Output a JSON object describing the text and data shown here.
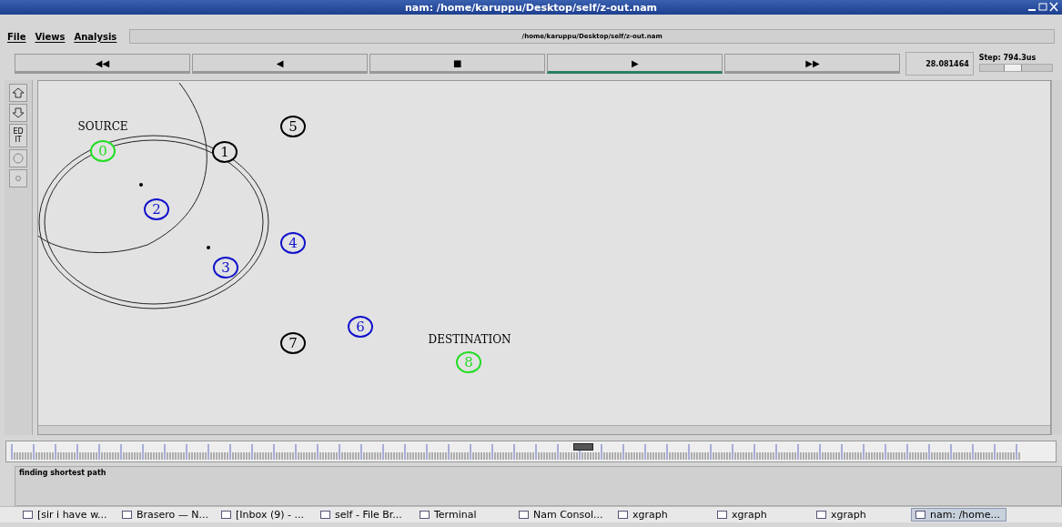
{
  "window": {
    "title": "nam: /home/karuppu/Desktop/self/z-out.nam"
  },
  "menu": [
    {
      "label": "File"
    },
    {
      "label": "Views"
    },
    {
      "label": "Analysis"
    }
  ],
  "file_path": "/home/karuppu/Desktop/self/z-out.nam",
  "controls": [
    {
      "label": "◀◀",
      "selected": false
    },
    {
      "label": "◀",
      "selected": false
    },
    {
      "label": "■",
      "selected": false
    },
    {
      "label": "▶",
      "selected": true
    },
    {
      "label": "▶▶",
      "selected": false
    }
  ],
  "time": "28.081464",
  "step": {
    "label": "Step: 794.3us",
    "level": 0.45
  },
  "tools": [
    {
      "kind": "up"
    },
    {
      "kind": "down"
    },
    {
      "kind": "edit",
      "label": "ED IT"
    },
    {
      "kind": "circle"
    },
    {
      "kind": "dot"
    }
  ],
  "canvas": {
    "labels": [
      {
        "text": "SOURCE"
      },
      {
        "text": "DESTINATION"
      }
    ],
    "nodes": [
      {
        "label": "5",
        "color": "#000000"
      },
      {
        "label": "0",
        "color": "#22dd22"
      },
      {
        "label": "1",
        "color": "#000000"
      },
      {
        "label": "2",
        "color": "#1111cc"
      },
      {
        "label": "4",
        "color": "#1111cc"
      },
      {
        "label": "3",
        "color": "#1111cc"
      },
      {
        "label": "6",
        "color": "#1111cc"
      },
      {
        "label": "7",
        "color": "#000000"
      },
      {
        "label": "8",
        "color": "#22dd22"
      }
    ]
  },
  "timeline": {
    "level": 0.55
  },
  "annotation": "finding shortest path",
  "taskbar": [
    {
      "label": "[sir i have w...",
      "selected": false
    },
    {
      "label": "Brasero — N...",
      "selected": false
    },
    {
      "label": "[Inbox (9) - ...",
      "selected": false
    },
    {
      "label": "self - File Br...",
      "selected": false
    },
    {
      "label": "Terminal",
      "selected": false
    },
    {
      "label": "Nam Consol...",
      "selected": false
    },
    {
      "label": "xgraph",
      "selected": false
    },
    {
      "label": "xgraph",
      "selected": false
    },
    {
      "label": "xgraph",
      "selected": false
    },
    {
      "label": "nam: /home...",
      "selected": true
    }
  ]
}
